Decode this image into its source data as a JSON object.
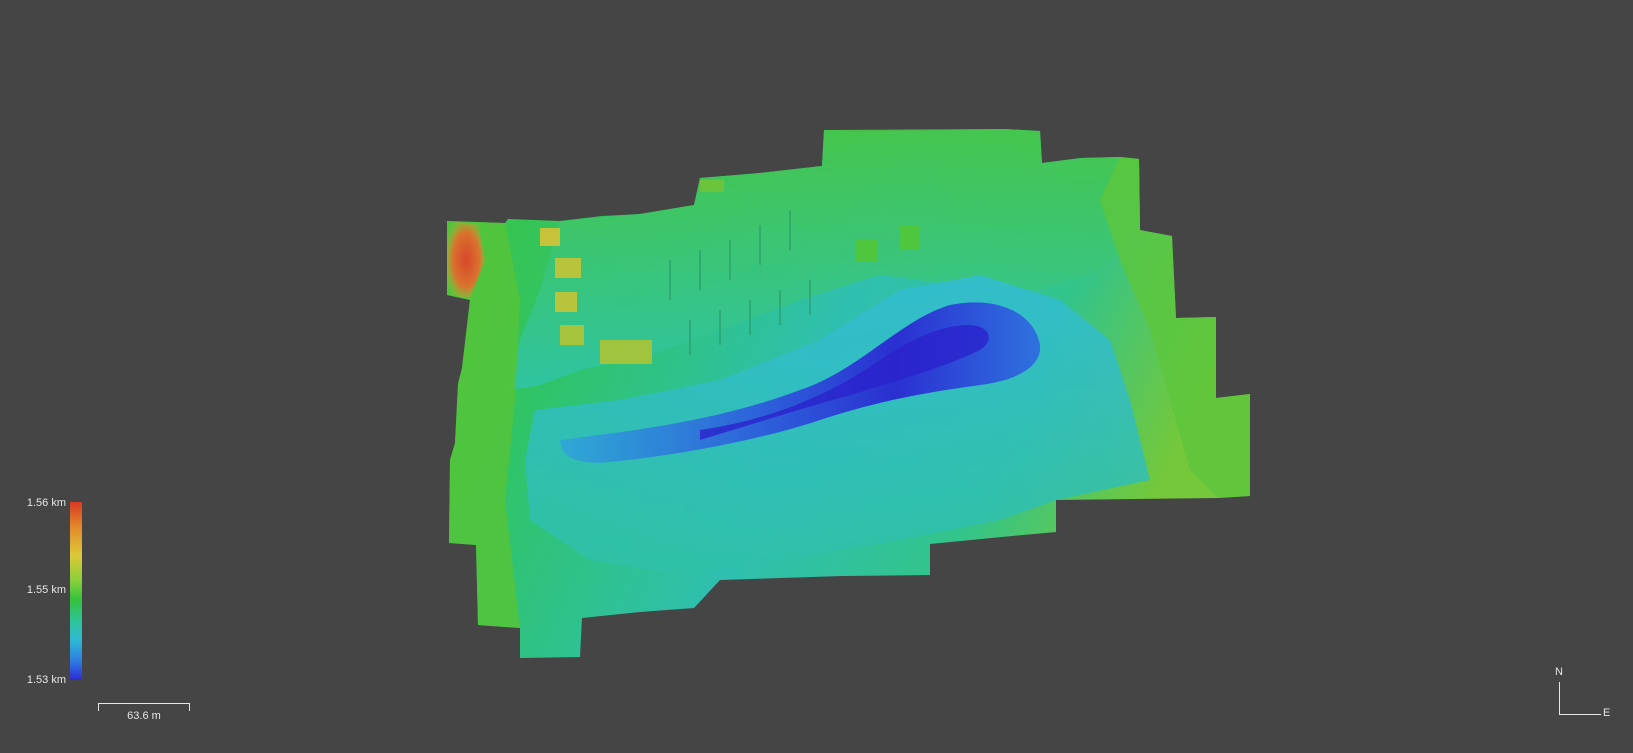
{
  "legend": {
    "title": "",
    "max_label": "1.56 km",
    "mid_label": "1.55 km",
    "min_label": "1.53 km",
    "colormap": [
      "#d83a24",
      "#e28a2a",
      "#dcc93a",
      "#8ad03a",
      "#32c23e",
      "#2fc4a0",
      "#2fb8d6",
      "#2f78e0",
      "#2d2ad6"
    ]
  },
  "scale_bar": {
    "label": "63.6 m"
  },
  "compass": {
    "north": "N",
    "east": "E"
  },
  "colors": {
    "background": "#454545",
    "text": "#e6e6e6"
  }
}
